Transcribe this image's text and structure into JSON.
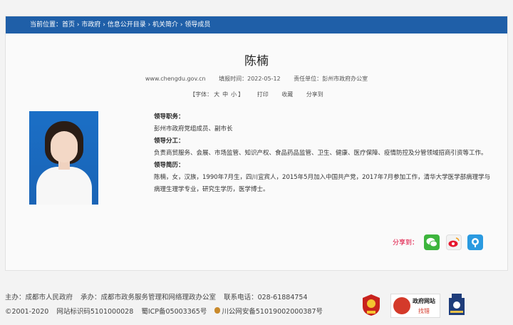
{
  "breadcrumb": {
    "prefix": "当前位置：",
    "items": [
      "首页",
      "市政府",
      "信息公开目录",
      "机关简介",
      "领导成员"
    ],
    "sep": " › "
  },
  "article": {
    "title": "陈楠",
    "source": "www.chengdu.gov.cn",
    "date_label": "填报时间：",
    "date": "2022-05-12",
    "unit_label": "责任单位：",
    "unit": "彭州市政府办公室"
  },
  "tools": {
    "font_label": "【字体：",
    "font_large": "大",
    "font_medium": "中",
    "font_small": "小",
    "font_close": "】",
    "print": "打印",
    "favorite": "收藏",
    "share": "分享到"
  },
  "profile": {
    "duty_heading": "领导职务：",
    "duty": "彭州市政府党组成员、副市长",
    "division_heading": "领导分工：",
    "division": "负责商贸服务、会展、市场监管、知识产权、食品药品监管、卫生、健康、医疗保障、疫情防控及分管领域招商引资等工作。",
    "bio_heading": "领导简历：",
    "bio": "陈楠，女，汉族，1990年7月生，四川宜宾人，2015年5月加入中国共产党，2017年7月参加工作，清华大学医学部病理学与病理生理学专业，研究生学历，医学博士。"
  },
  "share": {
    "label": "分享到：",
    "wechat_color": "#3db53d",
    "weibo_color": "#e8e8e8",
    "qzone_color": "#2a9ae0"
  },
  "footer": {
    "host": "主办：成都市人民政府",
    "organizer": "承办：成都市政务服务管理和网络理政办公室",
    "phone": "联系电话：028-61884754",
    "copyright": "©2001-2020",
    "site_id": "网站标识码5101000028",
    "icp": "蜀ICP备05003365号",
    "police": "川公网安备51019002000387号",
    "error_title": "政府网站",
    "error_action": "找错"
  }
}
